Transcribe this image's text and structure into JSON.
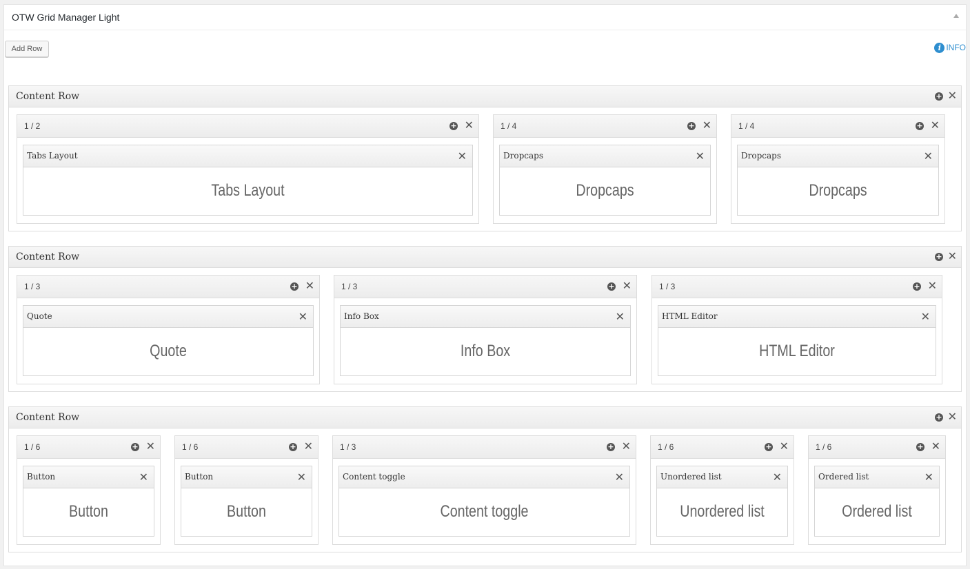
{
  "panel": {
    "title": "OTW Grid Manager Light",
    "add_row_label": "Add Row",
    "info_label": "INFO"
  },
  "icons": {
    "plus": "plus-circle-icon",
    "close": "close-x-icon",
    "info": "info-circle-icon"
  },
  "colors": {
    "accent": "#2e8ecf",
    "icon": "#555555"
  },
  "rows": [
    {
      "title": "Content Row",
      "columns": [
        {
          "size": "1 / 2",
          "widget": {
            "title": "Tabs Layout",
            "body": "Tabs Layout"
          }
        },
        {
          "size": "1 / 4",
          "widget": {
            "title": "Dropcaps",
            "body": "Dropcaps"
          }
        },
        {
          "size": "1 / 4",
          "widget": {
            "title": "Dropcaps",
            "body": "Dropcaps"
          }
        }
      ]
    },
    {
      "title": "Content Row",
      "columns": [
        {
          "size": "1 / 3",
          "widget": {
            "title": "Quote",
            "body": "Quote"
          }
        },
        {
          "size": "1 / 3",
          "widget": {
            "title": "Info Box",
            "body": "Info Box"
          }
        },
        {
          "size": "1 / 3",
          "widget": {
            "title": "HTML Editor",
            "body": "HTML Editor"
          }
        }
      ]
    },
    {
      "title": "Content Row",
      "columns": [
        {
          "size": "1 / 6",
          "widget": {
            "title": "Button",
            "body": "Button"
          }
        },
        {
          "size": "1 / 6",
          "widget": {
            "title": "Button",
            "body": "Button"
          }
        },
        {
          "size": "1 / 3",
          "widget": {
            "title": "Content toggle",
            "body": "Content toggle"
          }
        },
        {
          "size": "1 / 6",
          "widget": {
            "title": "Unordered list",
            "body": "Unordered list"
          }
        },
        {
          "size": "1 / 6",
          "widget": {
            "title": "Ordered list",
            "body": "Ordered list"
          }
        }
      ]
    }
  ]
}
